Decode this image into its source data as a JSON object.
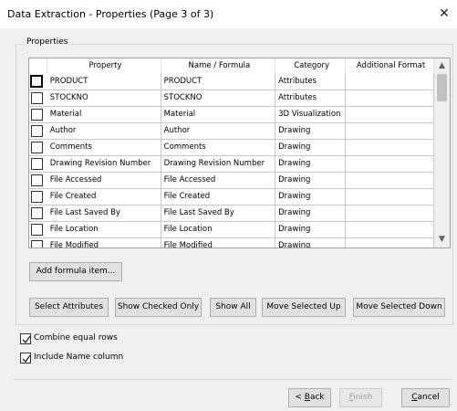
{
  "window": {
    "title": "Data Extraction - Properties (Page 3 of 3)",
    "close_glyph": "✕"
  },
  "group": {
    "label": "Properties"
  },
  "grid": {
    "columns": [
      "",
      "Property",
      "Name / Formula",
      "Category",
      "Additional Format"
    ],
    "rows": [
      {
        "checked": false,
        "property": "PRODUCT",
        "name": "PRODUCT",
        "category": "Attributes",
        "format": ""
      },
      {
        "checked": false,
        "property": "STOCKNO",
        "name": "STOCKNO",
        "category": "Attributes",
        "format": ""
      },
      {
        "checked": false,
        "property": "Material",
        "name": "Material",
        "category": "3D Visualization",
        "format": ""
      },
      {
        "checked": false,
        "property": "Author",
        "name": "Author",
        "category": "Drawing",
        "format": ""
      },
      {
        "checked": false,
        "property": "Comments",
        "name": "Comments",
        "category": "Drawing",
        "format": ""
      },
      {
        "checked": false,
        "property": "Drawing Revision Number",
        "name": "Drawing Revision Number",
        "category": "Drawing",
        "format": ""
      },
      {
        "checked": false,
        "property": "File Accessed",
        "name": "File Accessed",
        "category": "Drawing",
        "format": ""
      },
      {
        "checked": false,
        "property": "File Created",
        "name": "File Created",
        "category": "Drawing",
        "format": ""
      },
      {
        "checked": false,
        "property": "File Last Saved By",
        "name": "File Last Saved By",
        "category": "Drawing",
        "format": ""
      },
      {
        "checked": false,
        "property": "File Location",
        "name": "File Location",
        "category": "Drawing",
        "format": ""
      },
      {
        "checked": false,
        "property": "File Modified",
        "name": "File Modified",
        "category": "Drawing",
        "format": ""
      }
    ]
  },
  "buttons": {
    "add_formula": "Add formula item...",
    "select_attributes": "Select Attributes",
    "show_checked": "Show Checked Only",
    "show_all": "Show All",
    "move_up": "Move Selected Up",
    "move_down": "Move Selected Down"
  },
  "options": {
    "combine_rows": {
      "label": "Combine equal rows",
      "checked": true
    },
    "include_name": {
      "label": "Include Name column",
      "checked": true
    }
  },
  "footer": {
    "back": {
      "pre": "< ",
      "key": "B",
      "post": "ack"
    },
    "finish": {
      "key": "F",
      "post": "inish"
    },
    "cancel": {
      "key": "C",
      "post": "ancel"
    }
  },
  "colors": {
    "window_bg": "#f0f0f0",
    "grid_bg": "#ffffff",
    "button_bg": "#e1e1e1"
  }
}
